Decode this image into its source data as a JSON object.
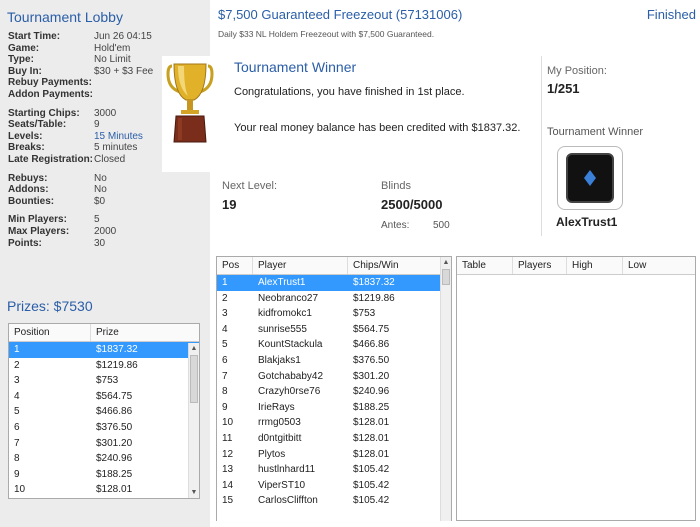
{
  "lobby": {
    "title": "Tournament Lobby",
    "info": [
      {
        "k": "Start Time:",
        "v": "Jun 26 04:15"
      },
      {
        "k": "Game:",
        "v": "Hold'em"
      },
      {
        "k": "Type:",
        "v": "No Limit"
      },
      {
        "k": "Buy In:",
        "v": "$30 + $3 Fee"
      },
      {
        "k": "Rebuy Payments:",
        "v": ""
      },
      {
        "k": "Addon Payments:",
        "v": ""
      },
      {
        "k": "Starting Chips:",
        "v": "3000"
      },
      {
        "k": "Seats/Table:",
        "v": "9"
      },
      {
        "k": "Levels:",
        "v": "15 Minutes"
      },
      {
        "k": "Breaks:",
        "v": "5 minutes"
      },
      {
        "k": "Late Registration:",
        "v": "Closed"
      },
      {
        "k": "Rebuys:",
        "v": "No"
      },
      {
        "k": "Addons:",
        "v": "No"
      },
      {
        "k": "Bounties:",
        "v": "$0"
      },
      {
        "k": "Min Players:",
        "v": "5"
      },
      {
        "k": "Max Players:",
        "v": "2000"
      },
      {
        "k": "Points:",
        "v": "30"
      }
    ],
    "prizes_title": "Prizes: $7530",
    "prize_headers": {
      "position": "Position",
      "prize": "Prize"
    },
    "prizes": [
      {
        "pos": "1",
        "prize": "$1837.32"
      },
      {
        "pos": "2",
        "prize": "$1219.86"
      },
      {
        "pos": "3",
        "prize": "$753"
      },
      {
        "pos": "4",
        "prize": "$564.75"
      },
      {
        "pos": "5",
        "prize": "$466.86"
      },
      {
        "pos": "6",
        "prize": "$376.50"
      },
      {
        "pos": "7",
        "prize": "$301.20"
      },
      {
        "pos": "8",
        "prize": "$240.96"
      },
      {
        "pos": "9",
        "prize": "$188.25"
      },
      {
        "pos": "10",
        "prize": "$128.01"
      }
    ]
  },
  "header": {
    "title": "$7,500 Guaranteed Freezeout (57131006)",
    "status": "Finished",
    "subtitle": "Daily $33 NL Holdem Freezeout with $7,500 Guaranteed."
  },
  "popup": {
    "title": "Tournament Winner",
    "line1": "Congratulations, you have finished in 1st place.",
    "line2": "Your real money balance has been credited with $1837.32."
  },
  "stats": {
    "position_label": "My Position:",
    "position_value": "1/251",
    "next_level_label": "Next Level:",
    "next_level_value": "19",
    "blinds_label": "Blinds",
    "blinds_value": "2500/5000",
    "antes_label": "Antes:",
    "antes_value": "500",
    "winner_label": "Tournament Winner",
    "winner_name": "AlexTrust1"
  },
  "players": {
    "headers": {
      "pos": "Pos",
      "player": "Player",
      "chips": "Chips/Win"
    },
    "rows": [
      {
        "pos": "1",
        "player": "AlexTrust1",
        "chips": "$1837.32"
      },
      {
        "pos": "2",
        "player": "Neobranco27",
        "chips": "$1219.86"
      },
      {
        "pos": "3",
        "player": "kidfromokc1",
        "chips": "$753"
      },
      {
        "pos": "4",
        "player": "sunrise555",
        "chips": "$564.75"
      },
      {
        "pos": "5",
        "player": "KountStackula",
        "chips": "$466.86"
      },
      {
        "pos": "6",
        "player": "Blakjaks1",
        "chips": "$376.50"
      },
      {
        "pos": "7",
        "player": "Gotchababy42",
        "chips": "$301.20"
      },
      {
        "pos": "8",
        "player": "Crazyh0rse76",
        "chips": "$240.96"
      },
      {
        "pos": "9",
        "player": "IrieRays",
        "chips": "$188.25"
      },
      {
        "pos": "10",
        "player": "rrmg0503",
        "chips": "$128.01"
      },
      {
        "pos": "11",
        "player": "d0ntgitbitt",
        "chips": "$128.01"
      },
      {
        "pos": "12",
        "player": "Plytos",
        "chips": "$128.01"
      },
      {
        "pos": "13",
        "player": "hustlnhard11",
        "chips": "$105.42"
      },
      {
        "pos": "14",
        "player": "ViperST10",
        "chips": "$105.42"
      },
      {
        "pos": "15",
        "player": "CarlosCliffton",
        "chips": "$105.42"
      }
    ]
  },
  "tables": {
    "headers": {
      "table": "Table",
      "players": "Players",
      "high": "High",
      "low": "Low"
    }
  }
}
